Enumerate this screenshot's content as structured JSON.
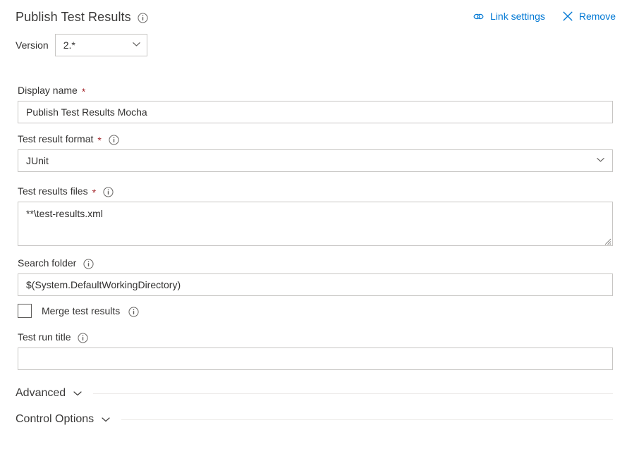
{
  "header": {
    "title": "Publish Test Results",
    "title_info_icon": "info-icon",
    "actions": [
      {
        "label": "Link settings",
        "icon": "link-icon"
      },
      {
        "label": "Remove",
        "icon": "close-icon"
      }
    ]
  },
  "version": {
    "label": "Version",
    "value": "2.*",
    "chevron_icon": "chevron-down-icon"
  },
  "fields": {
    "display_name": {
      "label": "Display name",
      "required": "*",
      "value": "Publish Test Results Mocha",
      "placeholder": ""
    },
    "test_result_format": {
      "label": "Test result format",
      "required": "*",
      "value": "JUnit",
      "info_icon": "info-icon",
      "chevron_icon": "chevron-down-icon"
    },
    "test_results_files": {
      "label": "Test results files",
      "required": "*",
      "value": "**\\test-results.xml",
      "placeholder": "",
      "info_icon": "info-icon",
      "resize_grip": "resize-grip-icon"
    },
    "search_folder": {
      "label": "Search folder",
      "value": "$(System.DefaultWorkingDirectory)",
      "placeholder": "",
      "info_icon": "info-icon"
    },
    "merge_test_results": {
      "label": "Merge test results",
      "checked": false,
      "info_icon": "info-icon"
    },
    "test_run_title": {
      "label": "Test run title",
      "value": "",
      "placeholder": "",
      "info_icon": "info-icon"
    }
  },
  "sections": [
    {
      "title": "Advanced",
      "chevron_icon": "chevron-down-icon",
      "expanded": false
    },
    {
      "title": "Control Options",
      "chevron_icon": "chevron-down-icon",
      "expanded": false
    }
  ],
  "colors": {
    "accent": "#0078d4",
    "required": "#a4262c",
    "text": "#323130",
    "border": "#c8c6c4",
    "divider": "#edebe9",
    "icon_gray": "#605e5c"
  }
}
